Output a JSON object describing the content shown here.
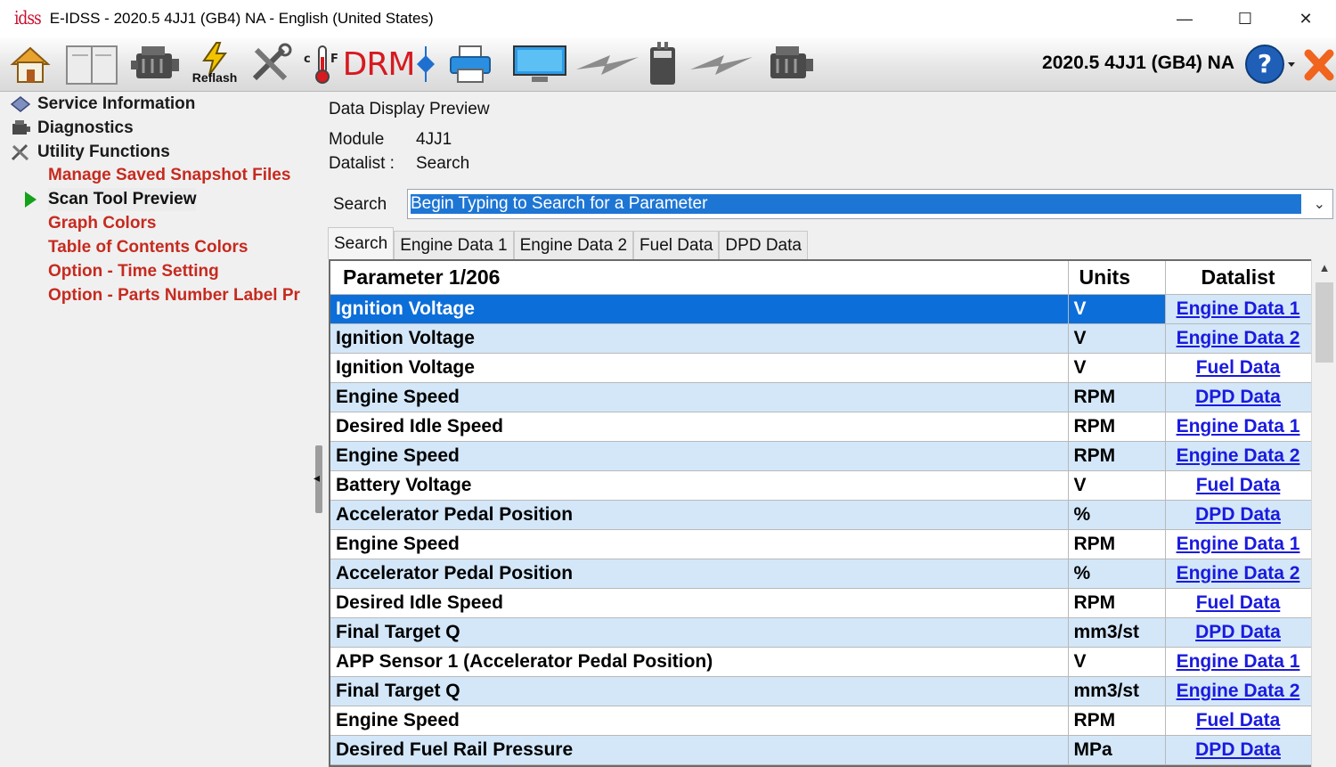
{
  "window": {
    "logo_text": "idss",
    "title": "E-IDSS - 2020.5 4JJ1 (GB4)  NA - English (United States)",
    "minimize": "—",
    "maximize": "☐",
    "close": "✕"
  },
  "toolbar": {
    "reflash_label": "Reflash",
    "drm_label": "DRM",
    "temp_label": "c  F",
    "vehicle_info": "2020.5 4JJ1 (GB4)  NA",
    "help_label": "?"
  },
  "sidebar": {
    "items": [
      {
        "label": "Service Information",
        "icon": "book-icon"
      },
      {
        "label": "Diagnostics",
        "icon": "engine-icon"
      },
      {
        "label": "Utility Functions",
        "icon": "tools-icon"
      }
    ],
    "subitems": [
      {
        "label": "Manage Saved Snapshot Files"
      },
      {
        "label": "Scan Tool Preview"
      },
      {
        "label": "Graph Colors"
      },
      {
        "label": "Table of Contents Colors"
      },
      {
        "label": "Option - Time Setting"
      },
      {
        "label": "Option - Parts Number Label Pr"
      }
    ]
  },
  "main": {
    "heading": "Data Display Preview",
    "module_label": "Module",
    "module_value": "4JJ1",
    "datalist_label": "Datalist :",
    "datalist_value": "Search",
    "search_label": "Search",
    "search_placeholder": "Begin Typing to Search for a Parameter",
    "tabs": [
      "Search",
      "Engine Data 1",
      "Engine Data 2",
      "Fuel Data",
      "DPD Data"
    ]
  },
  "grid": {
    "headers": {
      "parameter": "Parameter 1/206",
      "units": "Units",
      "datalist": "Datalist"
    },
    "rows": [
      {
        "parameter": "Ignition Voltage",
        "units": "V",
        "datalist": "Engine Data 1"
      },
      {
        "parameter": "Ignition Voltage",
        "units": "V",
        "datalist": "Engine Data 2"
      },
      {
        "parameter": "Ignition Voltage",
        "units": "V",
        "datalist": "Fuel Data"
      },
      {
        "parameter": "Engine Speed",
        "units": "RPM",
        "datalist": "DPD Data"
      },
      {
        "parameter": "Desired Idle Speed",
        "units": "RPM",
        "datalist": "Engine Data 1"
      },
      {
        "parameter": "Engine Speed",
        "units": "RPM",
        "datalist": "Engine Data 2"
      },
      {
        "parameter": "Battery Voltage",
        "units": "V",
        "datalist": "Fuel Data"
      },
      {
        "parameter": "Accelerator Pedal Position",
        "units": "%",
        "datalist": "DPD Data"
      },
      {
        "parameter": "Engine Speed",
        "units": "RPM",
        "datalist": "Engine Data 1"
      },
      {
        "parameter": "Accelerator Pedal Position",
        "units": "%",
        "datalist": "Engine Data 2"
      },
      {
        "parameter": "Desired Idle Speed",
        "units": "RPM",
        "datalist": "Fuel Data"
      },
      {
        "parameter": "Final Target Q",
        "units": "mm3/st",
        "datalist": "DPD Data"
      },
      {
        "parameter": "APP Sensor 1 (Accelerator Pedal Position)",
        "units": "V",
        "datalist": "Engine Data 1"
      },
      {
        "parameter": "Final Target Q",
        "units": "mm3/st",
        "datalist": "Engine Data 2"
      },
      {
        "parameter": "Engine Speed",
        "units": "RPM",
        "datalist": "Fuel Data"
      },
      {
        "parameter": "Desired Fuel Rail Pressure",
        "units": "MPa",
        "datalist": "DPD Data"
      }
    ]
  }
}
